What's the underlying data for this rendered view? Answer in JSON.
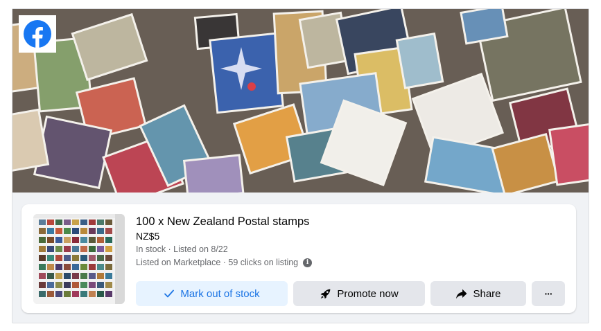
{
  "brand": {
    "logo_icon": "facebook-logo-icon",
    "color": "#1877f2"
  },
  "listing": {
    "title": "100 x New Zealand Postal stamps",
    "price": "NZ$5",
    "status": "In stock · Listed on 8/22",
    "marketplace_info": "Listed on Marketplace · 59 clicks on listing"
  },
  "actions": {
    "mark_out_of_stock": "Mark out of stock",
    "promote_now": "Promote now",
    "share": "Share",
    "more": "···"
  },
  "icons": {
    "mark_out_of_stock": "checkmark-icon",
    "promote_now": "rocket-icon",
    "share": "share-arrow-icon",
    "info": "info-icon"
  },
  "colors": {
    "primary_button_bg": "#e7f3ff",
    "primary_button_text": "#1b74e4",
    "secondary_button_bg": "#e4e6eb",
    "meta_text": "#65676b"
  }
}
